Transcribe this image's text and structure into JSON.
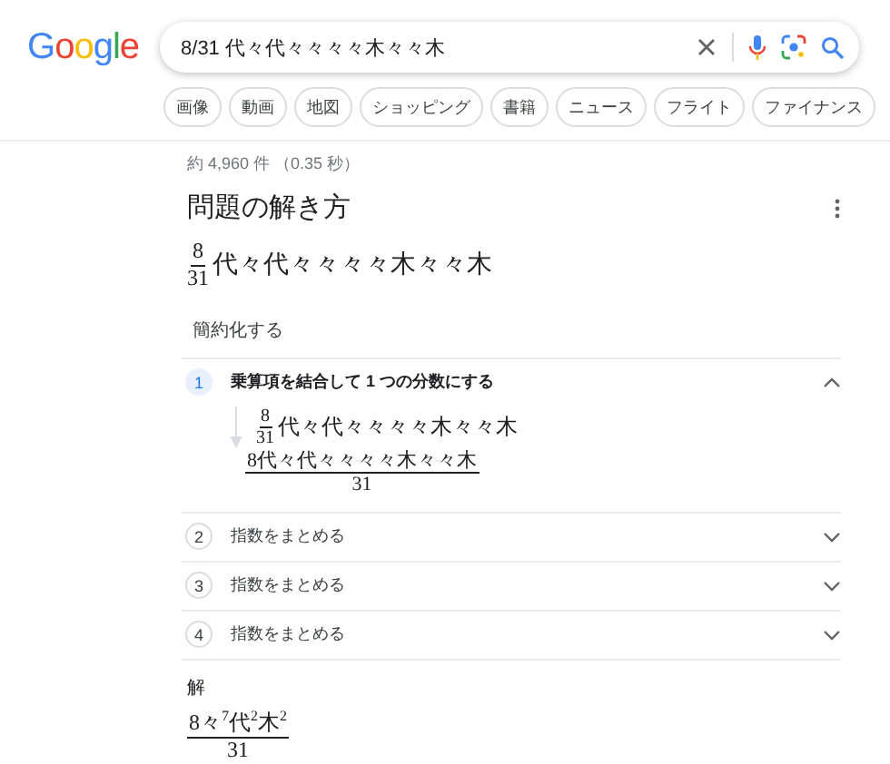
{
  "logo": "Google",
  "search": {
    "value": "8/31 代々代々々々々木々々木"
  },
  "chips": [
    "画像",
    "動画",
    "地図",
    "ショッピング",
    "書籍",
    "ニュース",
    "フライト",
    "ファイナンス"
  ],
  "result_stats": "約 4,960 件 （0.35 秒）",
  "solver": {
    "title": "問題の解き方",
    "problem": {
      "numerator": "8",
      "denominator": "31",
      "text": "代々代々々々々木々々木"
    },
    "task": "簡約化する",
    "steps": [
      {
        "number": "1",
        "title": "乗算項を結合して 1 つの分数にする",
        "expanded": true,
        "work": {
          "line": {
            "numerator": "8",
            "denominator": "31",
            "text": "代々代々々々々木々々木"
          },
          "result": {
            "numerator": "8代々代々々々々木々々木",
            "denominator": "31"
          }
        }
      },
      {
        "number": "2",
        "title": "指数をまとめる",
        "expanded": false
      },
      {
        "number": "3",
        "title": "指数をまとめる",
        "expanded": false
      },
      {
        "number": "4",
        "title": "指数をまとめる",
        "expanded": false
      }
    ],
    "answer_label": "解",
    "answer": {
      "numerator": "8々$^{7}$代$^{2}$木$^{2}$",
      "denominator": "31"
    }
  }
}
